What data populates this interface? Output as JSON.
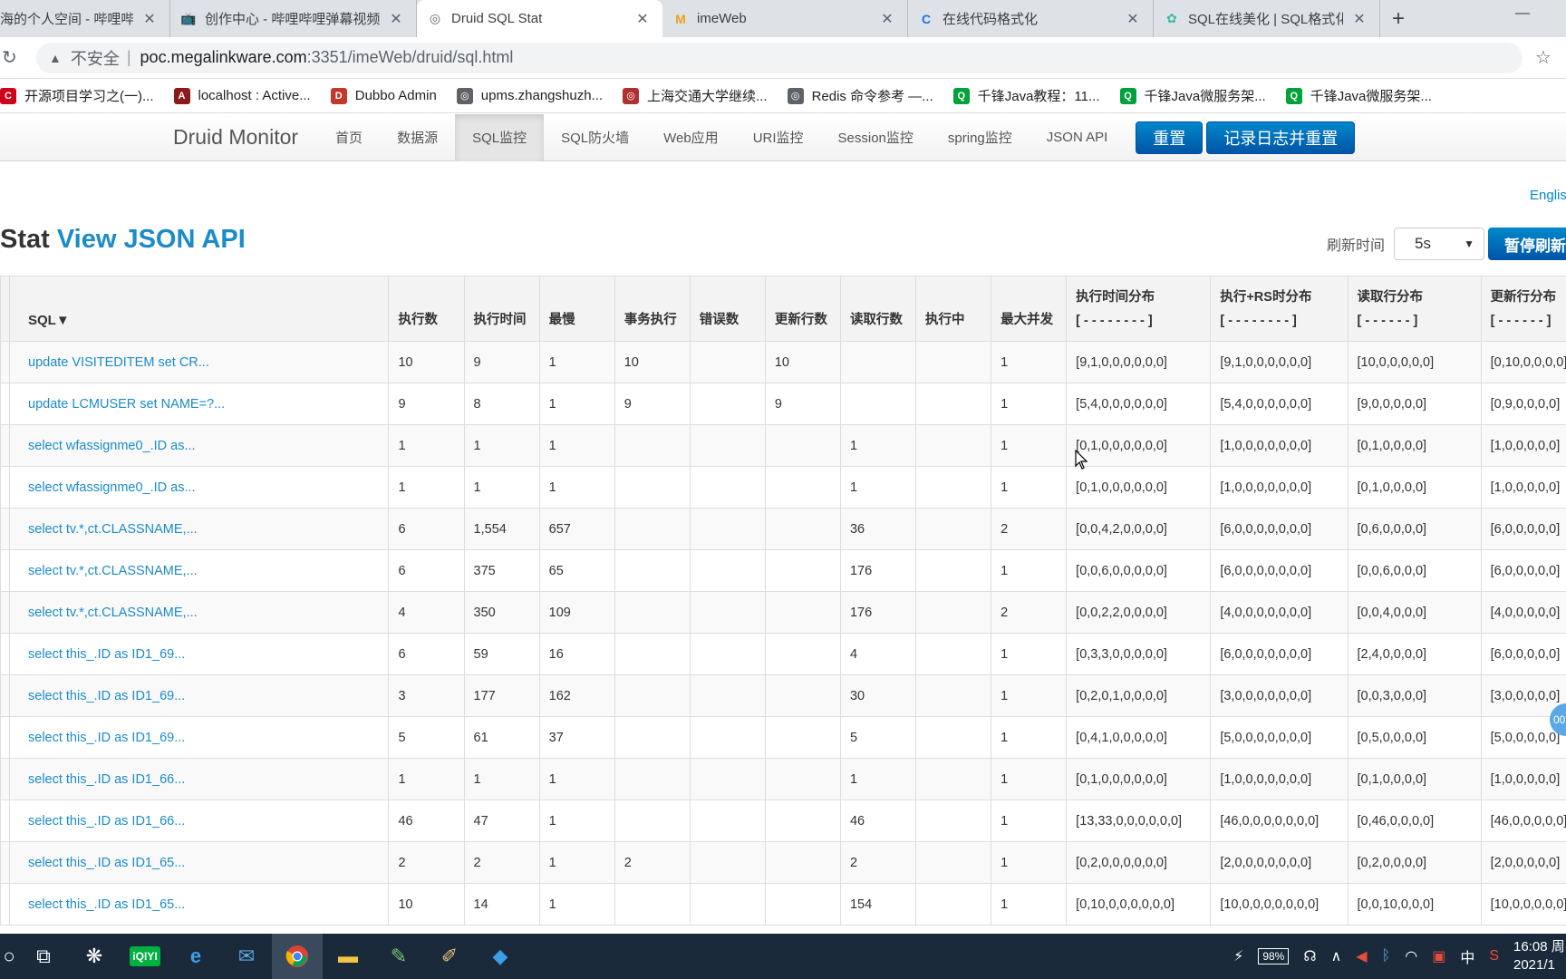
{
  "browser": {
    "tabs": [
      {
        "title": "海的个人空间 - 哔哩哔",
        "active": false
      },
      {
        "title": "创作中心 - 哔哩哔哩弹幕视频",
        "active": false
      },
      {
        "title": "Druid SQL Stat",
        "active": true
      },
      {
        "title": "imeWeb",
        "active": false
      },
      {
        "title": "在线代码格式化",
        "active": false
      },
      {
        "title": "SQL在线美化 | SQL格式化 | ",
        "active": false
      }
    ],
    "address": {
      "insecure_label": "不安全",
      "separator": "|",
      "url_host": "poc.megalinkware.com",
      "url_rest": ":3351/imeWeb/druid/sql.html"
    },
    "bookmarks": [
      {
        "label": "开源项目学习之(一)...",
        "color": "#d0021b",
        "icon": "C"
      },
      {
        "label": "localhost : Active...",
        "color": "#8b1a1a",
        "icon": "A"
      },
      {
        "label": "Dubbo Admin",
        "color": "#c0392b",
        "icon": "D"
      },
      {
        "label": "upms.zhangshuzh...",
        "color": "#5f6368",
        "icon": "◎"
      },
      {
        "label": "上海交通大学继续...",
        "color": "#b03030",
        "icon": "◎"
      },
      {
        "label": "Redis 命令参考 —...",
        "color": "#5f6368",
        "icon": "◎"
      },
      {
        "label": "千锋Java教程：11...",
        "color": "#00a23a",
        "icon": "Q"
      },
      {
        "label": "千锋Java微服务架...",
        "color": "#00a23a",
        "icon": "Q"
      },
      {
        "label": "千锋Java微服务架...",
        "color": "#00a23a",
        "icon": "Q"
      }
    ]
  },
  "druid": {
    "brand": "Druid Monitor",
    "nav": [
      {
        "label": "首页",
        "active": false
      },
      {
        "label": "数据源",
        "active": false
      },
      {
        "label": "SQL监控",
        "active": true
      },
      {
        "label": "SQL防火墙",
        "active": false
      },
      {
        "label": "Web应用",
        "active": false
      },
      {
        "label": "URI监控",
        "active": false
      },
      {
        "label": "Session监控",
        "active": false
      },
      {
        "label": "spring监控",
        "active": false
      },
      {
        "label": "JSON API",
        "active": false
      }
    ],
    "reset_label": "重置",
    "log_reset_label": "记录日志并重置",
    "english_link": "English",
    "page_title_prefix": "Stat ",
    "page_title_link": "View JSON API",
    "refresh_label": "刷新时间",
    "refresh_value": "5s",
    "pause_label": "暂停刷新"
  },
  "table": {
    "headers": [
      "SQL▼",
      "执行数",
      "执行时间",
      "最慢",
      "事务执行",
      "错误数",
      "更新行数",
      "读取行数",
      "执行中",
      "最大并发"
    ],
    "dist_headers": [
      {
        "label": "执行时间分布",
        "range": "[ - - - - - - - - ]"
      },
      {
        "label": "执行+RS时分布",
        "range": "[ - - - - - - - - ]"
      },
      {
        "label": "读取行分布",
        "range": "[ - - - - - - ]"
      },
      {
        "label": "更新行分布",
        "range": "[ - - - - - - ]"
      }
    ],
    "rows": [
      [
        "update VISITEDITEM set CR...",
        "10",
        "9",
        "1",
        "10",
        "",
        "10",
        "",
        "",
        "1",
        "[9,1,0,0,0,0,0,0]",
        "[9,1,0,0,0,0,0,0]",
        "[10,0,0,0,0,0]",
        "[0,10,0,0,0,0]"
      ],
      [
        "update LCMUSER set NAME=?...",
        "9",
        "8",
        "1",
        "9",
        "",
        "9",
        "",
        "",
        "1",
        "[5,4,0,0,0,0,0,0]",
        "[5,4,0,0,0,0,0,0]",
        "[9,0,0,0,0,0]",
        "[0,9,0,0,0,0]"
      ],
      [
        "select wfassignme0_.ID as...",
        "1",
        "1",
        "1",
        "",
        "",
        "",
        "1",
        "",
        "1",
        "[0,1,0,0,0,0,0,0]",
        "[1,0,0,0,0,0,0,0]",
        "[0,1,0,0,0,0]",
        "[1,0,0,0,0,0]"
      ],
      [
        "select wfassignme0_.ID as...",
        "1",
        "1",
        "1",
        "",
        "",
        "",
        "1",
        "",
        "1",
        "[0,1,0,0,0,0,0,0]",
        "[1,0,0,0,0,0,0,0]",
        "[0,1,0,0,0,0]",
        "[1,0,0,0,0,0]"
      ],
      [
        "select tv.*,ct.CLASSNAME,...",
        "6",
        "1,554",
        "657",
        "",
        "",
        "",
        "36",
        "",
        "2",
        "[0,0,4,2,0,0,0,0]",
        "[6,0,0,0,0,0,0,0]",
        "[0,6,0,0,0,0]",
        "[6,0,0,0,0,0]"
      ],
      [
        "select tv.*,ct.CLASSNAME,...",
        "6",
        "375",
        "65",
        "",
        "",
        "",
        "176",
        "",
        "1",
        "[0,0,6,0,0,0,0,0]",
        "[6,0,0,0,0,0,0,0]",
        "[0,0,6,0,0,0]",
        "[6,0,0,0,0,0]"
      ],
      [
        "select tv.*,ct.CLASSNAME,...",
        "4",
        "350",
        "109",
        "",
        "",
        "",
        "176",
        "",
        "2",
        "[0,0,2,2,0,0,0,0]",
        "[4,0,0,0,0,0,0,0]",
        "[0,0,4,0,0,0]",
        "[4,0,0,0,0,0]"
      ],
      [
        "select this_.ID as ID1_69...",
        "6",
        "59",
        "16",
        "",
        "",
        "",
        "4",
        "",
        "1",
        "[0,3,3,0,0,0,0,0]",
        "[6,0,0,0,0,0,0,0]",
        "[2,4,0,0,0,0]",
        "[6,0,0,0,0,0]"
      ],
      [
        "select this_.ID as ID1_69...",
        "3",
        "177",
        "162",
        "",
        "",
        "",
        "30",
        "",
        "1",
        "[0,2,0,1,0,0,0,0]",
        "[3,0,0,0,0,0,0,0]",
        "[0,0,3,0,0,0]",
        "[3,0,0,0,0,0]"
      ],
      [
        "select this_.ID as ID1_69...",
        "5",
        "61",
        "37",
        "",
        "",
        "",
        "5",
        "",
        "1",
        "[0,4,1,0,0,0,0,0]",
        "[5,0,0,0,0,0,0,0]",
        "[0,5,0,0,0,0]",
        "[5,0,0,0,0,0]"
      ],
      [
        "select this_.ID as ID1_66...",
        "1",
        "1",
        "1",
        "",
        "",
        "",
        "1",
        "",
        "1",
        "[0,1,0,0,0,0,0,0]",
        "[1,0,0,0,0,0,0,0]",
        "[0,1,0,0,0,0]",
        "[1,0,0,0,0,0]"
      ],
      [
        "select this_.ID as ID1_66...",
        "46",
        "47",
        "1",
        "",
        "",
        "",
        "46",
        "",
        "1",
        "[13,33,0,0,0,0,0,0]",
        "[46,0,0,0,0,0,0,0]",
        "[0,46,0,0,0,0]",
        "[46,0,0,0,0,0]"
      ],
      [
        "select this_.ID as ID1_65...",
        "2",
        "2",
        "1",
        "2",
        "",
        "",
        "2",
        "",
        "1",
        "[0,2,0,0,0,0,0,0]",
        "[2,0,0,0,0,0,0,0]",
        "[0,2,0,0,0,0]",
        "[2,0,0,0,0,0]"
      ],
      [
        "select this_.ID as ID1_65...",
        "10",
        "14",
        "1",
        "",
        "",
        "",
        "154",
        "",
        "1",
        "[0,10,0,0,0,0,0,0]",
        "[10,0,0,0,0,0,0,0]",
        "[0,0,10,0,0,0]",
        "[10,0,0,0,0,0]"
      ]
    ]
  },
  "floating_bubble": "00",
  "taskbar": {
    "battery": "98%",
    "ime": "中",
    "time": "16:08 周",
    "date": "2021/1"
  }
}
